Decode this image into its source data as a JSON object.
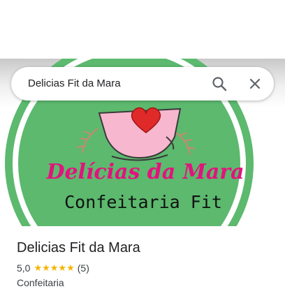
{
  "search": {
    "query": "Delicias Fit da Mara",
    "search_icon": "search-icon",
    "close_icon": "close-icon"
  },
  "hero_image": {
    "logo_script_text": "Delícias  da Mara",
    "logo_subtitle": "Confeitaria Fit",
    "colors": {
      "circle_green": "#5cb96e",
      "ring_white": "#ffffff",
      "script_pink": "#e3127e",
      "cup_pink": "#f7b7cf",
      "heart_red": "#e02a2a"
    }
  },
  "place": {
    "name": "Delicias Fit da Mara",
    "rating": "5,0",
    "stars": "★★★★★",
    "review_count": "(5)",
    "category": "Confeitaria"
  }
}
